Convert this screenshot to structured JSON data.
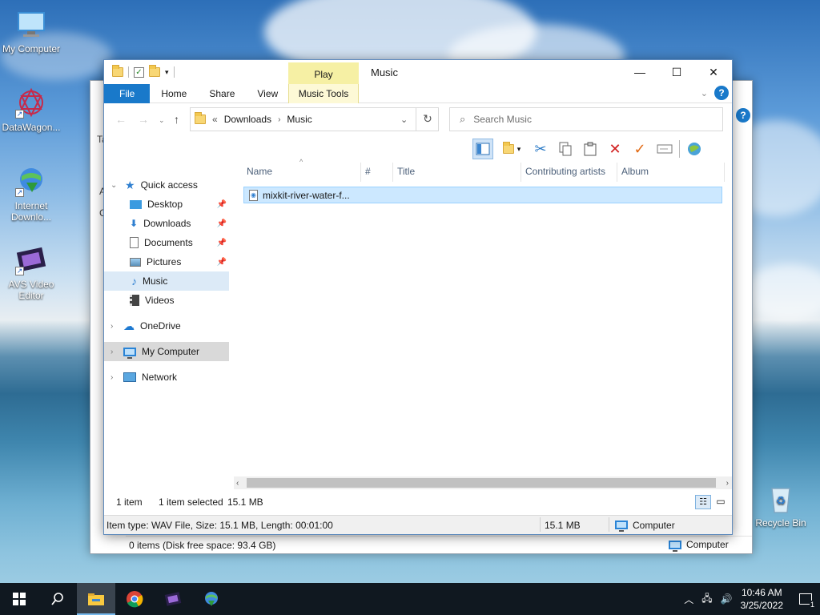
{
  "desktop": {
    "icons": [
      {
        "label": "My Computer",
        "icon": "monitor-icon"
      },
      {
        "label": "DataWagon...",
        "icon": "datawagon-icon"
      },
      {
        "label": "Internet Downlo...",
        "icon": "idm-icon"
      },
      {
        "label": "AVS Video Editor",
        "icon": "avs-icon"
      },
      {
        "label": "Recycle Bin",
        "icon": "recycle-bin-icon"
      }
    ]
  },
  "back_window": {
    "status": "0 items (Disk free space: 93.4 GB)",
    "location": "Computer",
    "partial_labels": [
      "Ta",
      "A",
      "C"
    ]
  },
  "window": {
    "title": "Music",
    "contextual_tab": "Play",
    "ribbon_tabs": [
      "File",
      "Home",
      "Share",
      "View",
      "Music Tools"
    ],
    "breadcrumb": {
      "prefix": "«",
      "parts": [
        "Downloads",
        "Music"
      ]
    },
    "search_placeholder": "Search Music",
    "nav": {
      "quick_access": "Quick access",
      "items": [
        {
          "label": "Desktop",
          "icon": "desktop-folder-icon",
          "pinned": true
        },
        {
          "label": "Downloads",
          "icon": "downloads-icon",
          "pinned": true
        },
        {
          "label": "Documents",
          "icon": "documents-icon",
          "pinned": true
        },
        {
          "label": "Pictures",
          "icon": "pictures-icon",
          "pinned": true
        },
        {
          "label": "Music",
          "icon": "music-icon",
          "pinned": false,
          "selected": true
        },
        {
          "label": "Videos",
          "icon": "videos-icon",
          "pinned": false
        }
      ],
      "onedrive": "OneDrive",
      "my_computer": "My Computer",
      "network": "Network"
    },
    "columns": [
      "Name",
      "#",
      "Title",
      "Contributing artists",
      "Album"
    ],
    "files": [
      {
        "name": "mixkit-river-water-f...",
        "icon": "wav-file-icon"
      }
    ],
    "status": {
      "count": "1 item",
      "selected": "1 item selected",
      "size": "15.1 MB"
    },
    "details_bar": {
      "info": "Item type: WAV File, Size: 15.1 MB, Length: 00:01:00",
      "size": "15.1 MB",
      "location": "Computer"
    }
  },
  "taskbar": {
    "apps": [
      "file-explorer-icon",
      "chrome-icon",
      "avs-icon",
      "idm-icon"
    ],
    "time": "10:46 AM",
    "date": "3/25/2022",
    "notification_count": "1"
  }
}
